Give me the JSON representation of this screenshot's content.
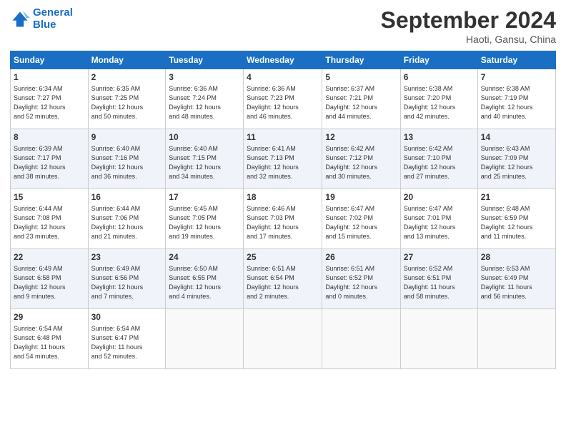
{
  "header": {
    "logo_line1": "General",
    "logo_line2": "Blue",
    "month": "September 2024",
    "location": "Haoti, Gansu, China"
  },
  "weekdays": [
    "Sunday",
    "Monday",
    "Tuesday",
    "Wednesday",
    "Thursday",
    "Friday",
    "Saturday"
  ],
  "weeks": [
    [
      {
        "day": "1",
        "info": "Sunrise: 6:34 AM\nSunset: 7:27 PM\nDaylight: 12 hours\nand 52 minutes."
      },
      {
        "day": "2",
        "info": "Sunrise: 6:35 AM\nSunset: 7:25 PM\nDaylight: 12 hours\nand 50 minutes."
      },
      {
        "day": "3",
        "info": "Sunrise: 6:36 AM\nSunset: 7:24 PM\nDaylight: 12 hours\nand 48 minutes."
      },
      {
        "day": "4",
        "info": "Sunrise: 6:36 AM\nSunset: 7:23 PM\nDaylight: 12 hours\nand 46 minutes."
      },
      {
        "day": "5",
        "info": "Sunrise: 6:37 AM\nSunset: 7:21 PM\nDaylight: 12 hours\nand 44 minutes."
      },
      {
        "day": "6",
        "info": "Sunrise: 6:38 AM\nSunset: 7:20 PM\nDaylight: 12 hours\nand 42 minutes."
      },
      {
        "day": "7",
        "info": "Sunrise: 6:38 AM\nSunset: 7:19 PM\nDaylight: 12 hours\nand 40 minutes."
      }
    ],
    [
      {
        "day": "8",
        "info": "Sunrise: 6:39 AM\nSunset: 7:17 PM\nDaylight: 12 hours\nand 38 minutes."
      },
      {
        "day": "9",
        "info": "Sunrise: 6:40 AM\nSunset: 7:16 PM\nDaylight: 12 hours\nand 36 minutes."
      },
      {
        "day": "10",
        "info": "Sunrise: 6:40 AM\nSunset: 7:15 PM\nDaylight: 12 hours\nand 34 minutes."
      },
      {
        "day": "11",
        "info": "Sunrise: 6:41 AM\nSunset: 7:13 PM\nDaylight: 12 hours\nand 32 minutes."
      },
      {
        "day": "12",
        "info": "Sunrise: 6:42 AM\nSunset: 7:12 PM\nDaylight: 12 hours\nand 30 minutes."
      },
      {
        "day": "13",
        "info": "Sunrise: 6:42 AM\nSunset: 7:10 PM\nDaylight: 12 hours\nand 27 minutes."
      },
      {
        "day": "14",
        "info": "Sunrise: 6:43 AM\nSunset: 7:09 PM\nDaylight: 12 hours\nand 25 minutes."
      }
    ],
    [
      {
        "day": "15",
        "info": "Sunrise: 6:44 AM\nSunset: 7:08 PM\nDaylight: 12 hours\nand 23 minutes."
      },
      {
        "day": "16",
        "info": "Sunrise: 6:44 AM\nSunset: 7:06 PM\nDaylight: 12 hours\nand 21 minutes."
      },
      {
        "day": "17",
        "info": "Sunrise: 6:45 AM\nSunset: 7:05 PM\nDaylight: 12 hours\nand 19 minutes."
      },
      {
        "day": "18",
        "info": "Sunrise: 6:46 AM\nSunset: 7:03 PM\nDaylight: 12 hours\nand 17 minutes."
      },
      {
        "day": "19",
        "info": "Sunrise: 6:47 AM\nSunset: 7:02 PM\nDaylight: 12 hours\nand 15 minutes."
      },
      {
        "day": "20",
        "info": "Sunrise: 6:47 AM\nSunset: 7:01 PM\nDaylight: 12 hours\nand 13 minutes."
      },
      {
        "day": "21",
        "info": "Sunrise: 6:48 AM\nSunset: 6:59 PM\nDaylight: 12 hours\nand 11 minutes."
      }
    ],
    [
      {
        "day": "22",
        "info": "Sunrise: 6:49 AM\nSunset: 6:58 PM\nDaylight: 12 hours\nand 9 minutes."
      },
      {
        "day": "23",
        "info": "Sunrise: 6:49 AM\nSunset: 6:56 PM\nDaylight: 12 hours\nand 7 minutes."
      },
      {
        "day": "24",
        "info": "Sunrise: 6:50 AM\nSunset: 6:55 PM\nDaylight: 12 hours\nand 4 minutes."
      },
      {
        "day": "25",
        "info": "Sunrise: 6:51 AM\nSunset: 6:54 PM\nDaylight: 12 hours\nand 2 minutes."
      },
      {
        "day": "26",
        "info": "Sunrise: 6:51 AM\nSunset: 6:52 PM\nDaylight: 12 hours\nand 0 minutes."
      },
      {
        "day": "27",
        "info": "Sunrise: 6:52 AM\nSunset: 6:51 PM\nDaylight: 11 hours\nand 58 minutes."
      },
      {
        "day": "28",
        "info": "Sunrise: 6:53 AM\nSunset: 6:49 PM\nDaylight: 11 hours\nand 56 minutes."
      }
    ],
    [
      {
        "day": "29",
        "info": "Sunrise: 6:54 AM\nSunset: 6:48 PM\nDaylight: 11 hours\nand 54 minutes."
      },
      {
        "day": "30",
        "info": "Sunrise: 6:54 AM\nSunset: 6:47 PM\nDaylight: 11 hours\nand 52 minutes."
      },
      {
        "day": "",
        "info": ""
      },
      {
        "day": "",
        "info": ""
      },
      {
        "day": "",
        "info": ""
      },
      {
        "day": "",
        "info": ""
      },
      {
        "day": "",
        "info": ""
      }
    ]
  ]
}
